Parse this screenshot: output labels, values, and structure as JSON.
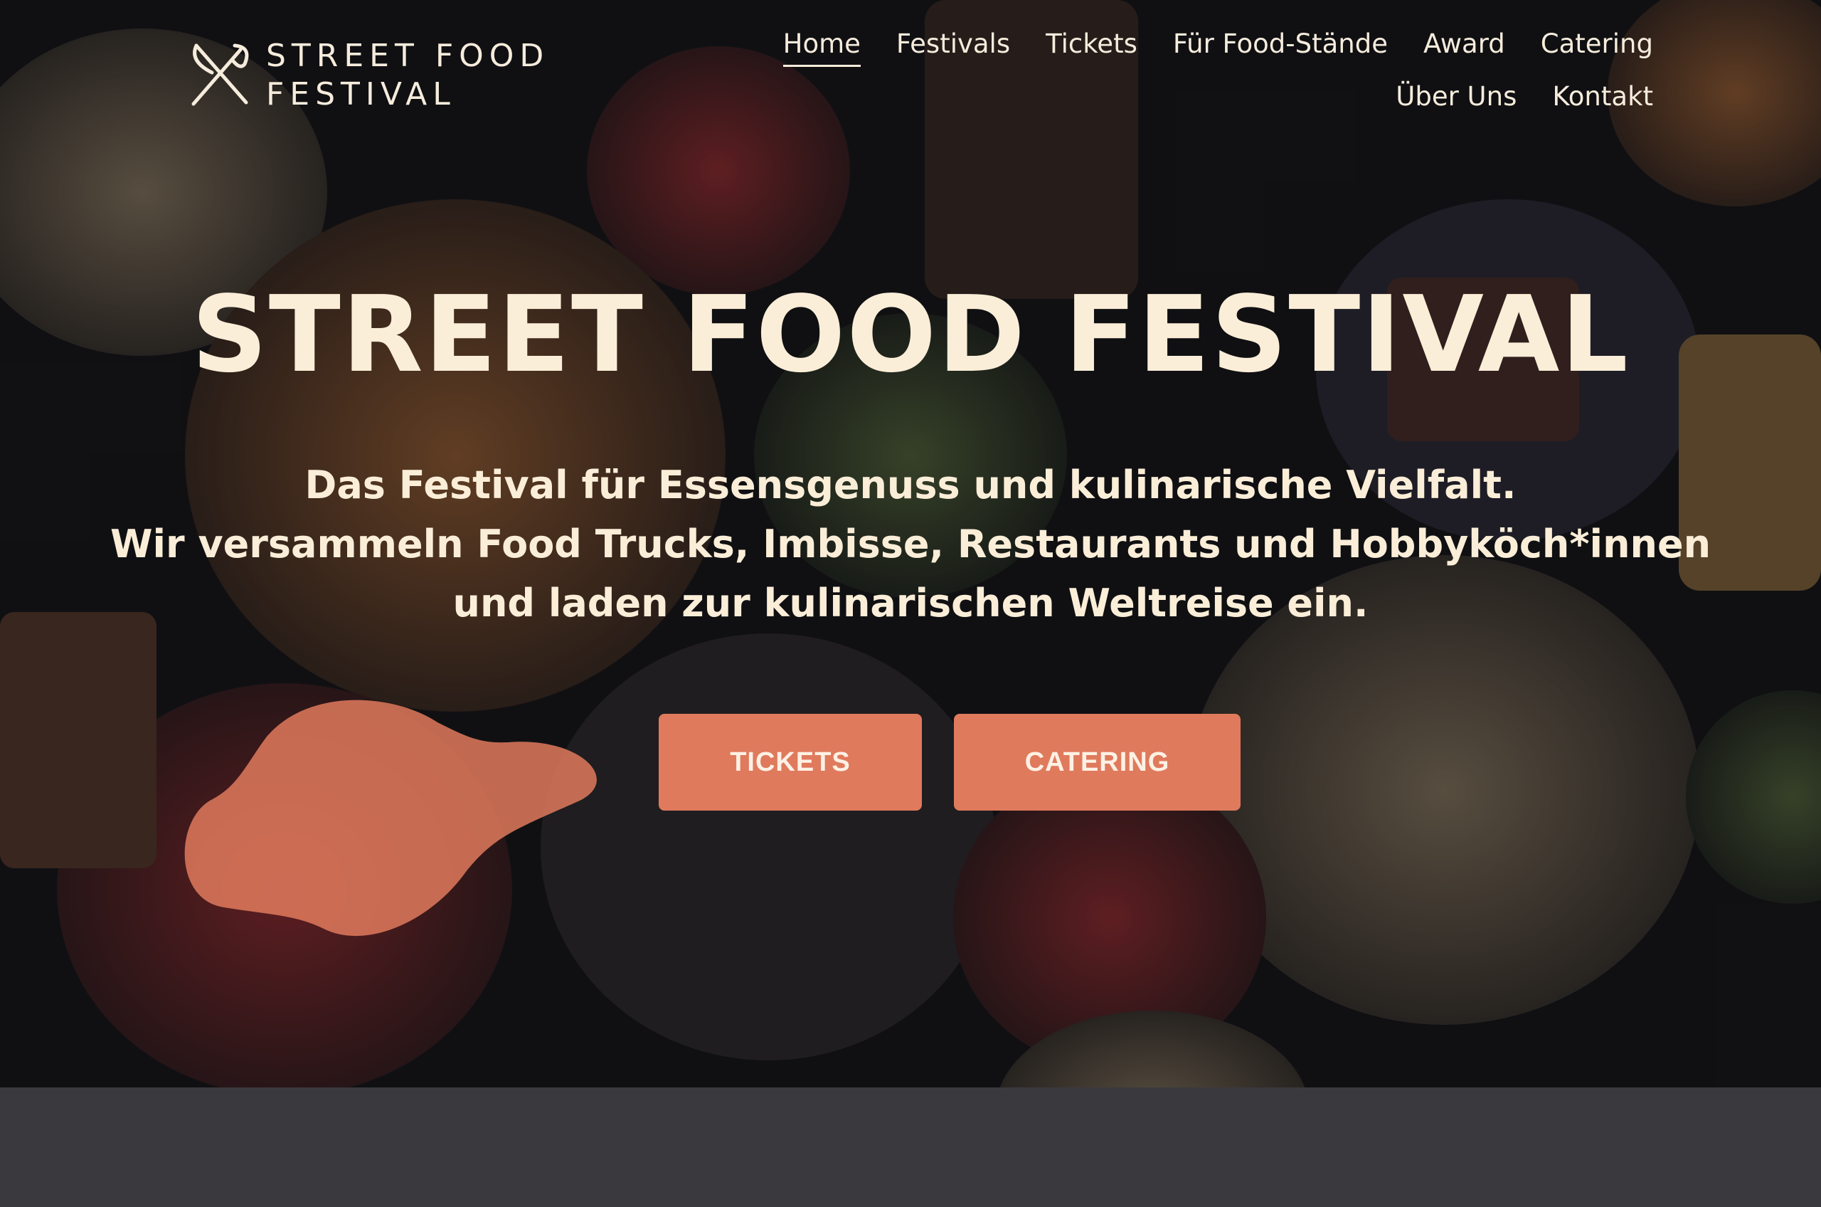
{
  "logo": {
    "line1": "STREET FOOD",
    "line2": "FESTIVAL",
    "icon": "crossed-fork-knife-icon"
  },
  "nav": {
    "items": [
      {
        "label": "Home",
        "active": true
      },
      {
        "label": "Festivals"
      },
      {
        "label": "Tickets"
      },
      {
        "label": "Für Food-Stände"
      },
      {
        "label": "Award"
      },
      {
        "label": "Catering"
      },
      {
        "label": "Über Uns"
      },
      {
        "label": "Kontakt"
      }
    ]
  },
  "hero": {
    "title": "STREET FOOD FESTIVAL",
    "subtitle_lines": [
      "Das Festival für Essensgenuss und kulinarische Vielfalt.",
      "Wir versammeln Food Trucks, Imbisse, Restaurants und Hobbyköch*innen",
      "und laden zur kulinarischen Weltreise ein."
    ],
    "buttons": {
      "tickets": "TICKETS",
      "catering": "CATERING"
    }
  },
  "colors": {
    "accent": "#e07a5d",
    "text_light": "#fbeed8",
    "footer_bg": "#3a3a3e"
  }
}
